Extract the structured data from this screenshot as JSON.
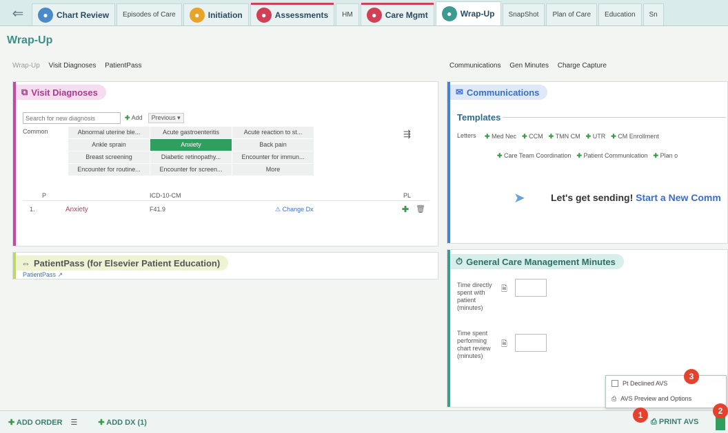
{
  "tabs": [
    {
      "label": "Chart Review",
      "kind": "big",
      "icon": "chart-review-icon",
      "color": "#4a8ac9"
    },
    {
      "label": "Episodes of Care",
      "kind": "small"
    },
    {
      "label": "Initiation",
      "kind": "big",
      "icon": "initiation-icon",
      "color": "#e6a52a"
    },
    {
      "label": "Assessments",
      "kind": "big",
      "icon": "assessments-icon",
      "color": "#d04056",
      "top": "#d04056"
    },
    {
      "label": "HM",
      "kind": "small"
    },
    {
      "label": "Care Mgmt",
      "kind": "big",
      "icon": "care-mgmt-icon",
      "color": "#d04056",
      "top": "#d04056"
    },
    {
      "label": "Wrap-Up",
      "kind": "big",
      "icon": "wrap-up-icon",
      "color": "#3c9a8f",
      "active": true
    },
    {
      "label": "SnapShot",
      "kind": "small"
    },
    {
      "label": "Plan of Care",
      "kind": "small"
    },
    {
      "label": "Education",
      "kind": "small"
    },
    {
      "label": "Sn",
      "kind": "small"
    }
  ],
  "page": {
    "title": "Wrap-Up"
  },
  "subnav_left": {
    "dim": "Wrap-Up",
    "items": [
      "Visit Diagnoses",
      "PatientPass"
    ]
  },
  "subnav_right": {
    "items": [
      "Communications",
      "Gen Minutes",
      "Charge Capture"
    ]
  },
  "visit_dx": {
    "title": "Visit Diagnoses",
    "search_placeholder": "Search for new diagnosis",
    "add_label": "Add",
    "previous_label": "Previous",
    "common_label": "Common",
    "common": [
      "Abnormal uterine ble...",
      "Acute gastroenteritis",
      "Acute reaction to st...",
      "Ankle sprain",
      "Anxiety",
      "Back pain",
      "Breast screening",
      "Diabetic retinopathy...",
      "Encounter for immun...",
      "Encounter for routine...",
      "Encounter for screen...",
      "More"
    ],
    "selected_index": 4,
    "col_p": "P",
    "col_icd": "ICD-10-CM",
    "col_pl": "PL",
    "row": {
      "num": "1.",
      "name": "Anxiety",
      "code": "F41.9",
      "change": "Change Dx"
    }
  },
  "patientpass": {
    "title": "PatientPass (for Elsevier Patient Education)",
    "link": "PatientPass"
  },
  "communications": {
    "title": "Communications",
    "templates_label": "Templates",
    "letters_label": "Letters",
    "letters_row1": [
      "Med Nec",
      "CCM",
      "TMN CM",
      "UTR",
      "CM Enrollment"
    ],
    "letters_row2": [
      "Care Team Coordination",
      "Patient Communication",
      "Plan o"
    ],
    "sending_text": "Let's get sending!",
    "sending_link": "Start a New Comm"
  },
  "gen_minutes": {
    "title": "General Care Management Minutes",
    "field1": "Time directly spent with patient (minutes)",
    "field2": "Time spent performing chart review (minutes)"
  },
  "footer": {
    "add_order": "ADD ORDER",
    "add_dx": "ADD DX (1)",
    "print_avs": "PRINT AVS"
  },
  "popup": {
    "declined": "Pt Declined AVS",
    "preview": "AVS Preview and Options"
  },
  "badges": [
    "1",
    "2",
    "3"
  ],
  "colors": {
    "accent": "#3c8f88",
    "dx_pink": "#c548a6",
    "comm_blue": "#4a7fd6",
    "green": "#2f9e5f",
    "badge": "#e4412e"
  }
}
